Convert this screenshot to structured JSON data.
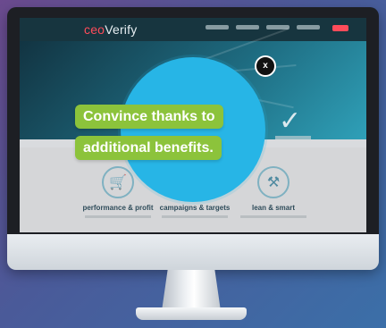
{
  "site": {
    "logo_prefix": "ceo",
    "logo_main": "Verify"
  },
  "overlay": {
    "headline_line1": "Convince thanks to",
    "headline_line2": "additional benefits.",
    "close_label": "x"
  },
  "features": [
    {
      "title": "performance & profit",
      "icon": "cart-icon"
    },
    {
      "title": "campaigns & targets",
      "icon": "target-icon"
    },
    {
      "title": "lean & smart",
      "icon": "tools-icon"
    }
  ],
  "colors": {
    "bubble": "#27b5e6",
    "banner": "#8cc33b",
    "nav": "#17353f",
    "accent": "#ff4c5a"
  }
}
